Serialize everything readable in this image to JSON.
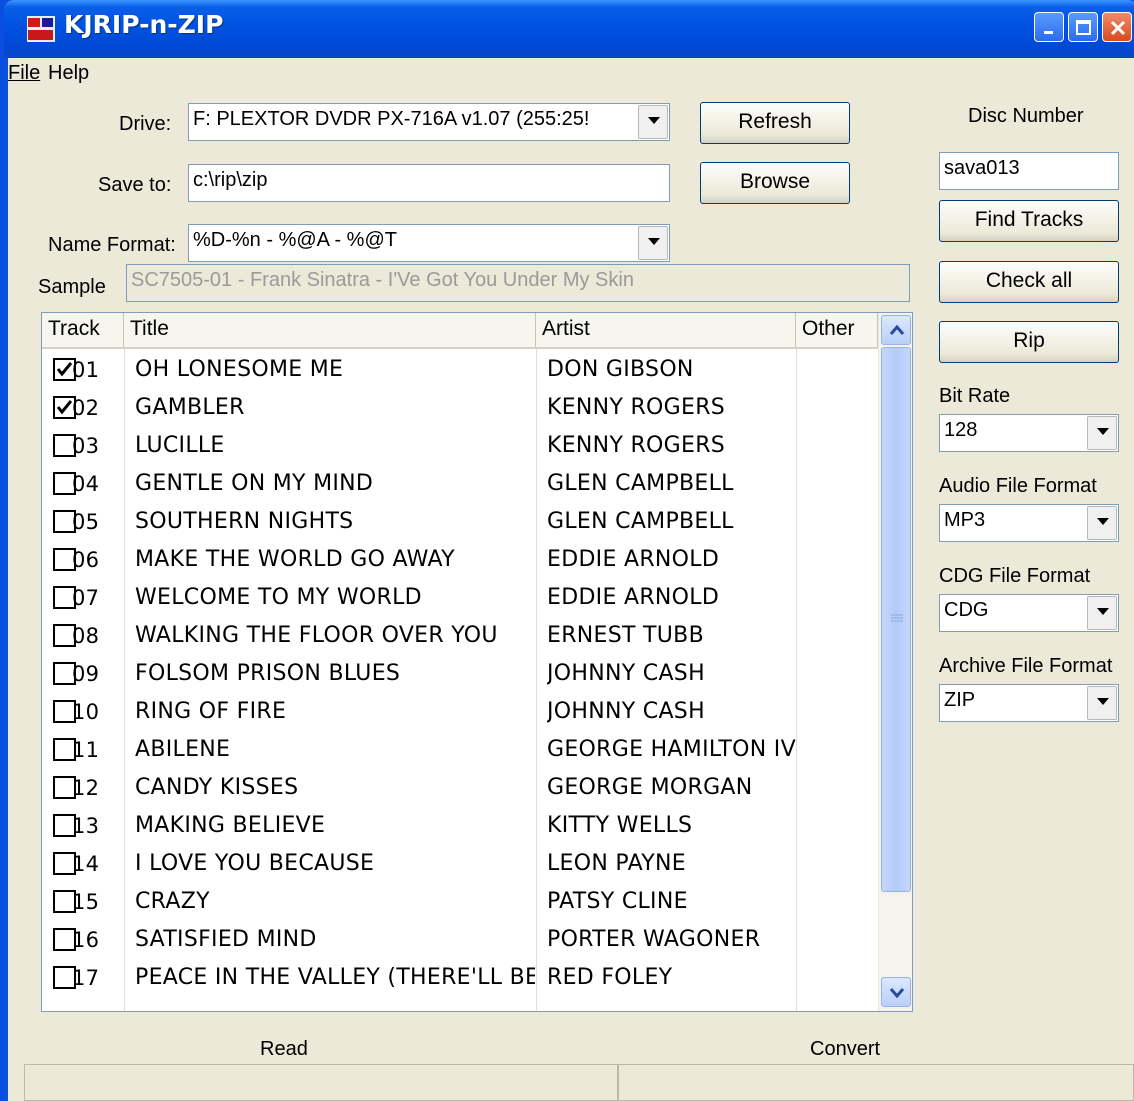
{
  "window": {
    "title": "KJRIP-n-ZIP",
    "accent": "#0052e0"
  },
  "menu": {
    "file": "File",
    "help": "Help"
  },
  "drive": {
    "label": "Drive:",
    "value": "F: PLEXTOR DVDR   PX-716A v1.07 (255:25!"
  },
  "save_to": {
    "label": "Save to:",
    "value": "c:\\rip\\zip"
  },
  "name_format": {
    "label": "Name Format:",
    "value": "%D-%n - %@A - %@T"
  },
  "sample": {
    "label": "Sample",
    "value": "SC7505-01 - Frank Sinatra - I'Ve Got You Under My Skin"
  },
  "buttons": {
    "refresh": "Refresh",
    "browse": "Browse",
    "find_tracks": "Find Tracks",
    "check_all": "Check all",
    "rip": "Rip"
  },
  "disc_number": {
    "label": "Disc Number",
    "value": "sava013"
  },
  "bit_rate": {
    "label": "Bit Rate",
    "value": "128"
  },
  "audio_format": {
    "label": "Audio File Format",
    "value": "MP3"
  },
  "cdg_format": {
    "label": "CDG File Format",
    "value": "CDG"
  },
  "archive_format": {
    "label": "Archive File Format",
    "value": "ZIP"
  },
  "columns": {
    "track": "Track",
    "title": "Title",
    "artist": "Artist",
    "other": "Other"
  },
  "tracks": [
    {
      "track": "01",
      "title": "OH LONESOME ME",
      "artist": "DON GIBSON",
      "checked": true
    },
    {
      "track": "02",
      "title": "GAMBLER",
      "artist": "KENNY ROGERS",
      "checked": true
    },
    {
      "track": "03",
      "title": "LUCILLE",
      "artist": "KENNY ROGERS",
      "checked": false
    },
    {
      "track": "04",
      "title": "GENTLE ON MY MIND",
      "artist": "GLEN CAMPBELL",
      "checked": false
    },
    {
      "track": "05",
      "title": "SOUTHERN NIGHTS",
      "artist": "GLEN CAMPBELL",
      "checked": false
    },
    {
      "track": "06",
      "title": "MAKE THE WORLD GO AWAY",
      "artist": "EDDIE ARNOLD",
      "checked": false
    },
    {
      "track": "07",
      "title": "WELCOME TO MY WORLD",
      "artist": "EDDIE ARNOLD",
      "checked": false
    },
    {
      "track": "08",
      "title": "WALKING THE FLOOR OVER YOU",
      "artist": "ERNEST TUBB",
      "checked": false
    },
    {
      "track": "09",
      "title": "FOLSOM PRISON BLUES",
      "artist": "JOHNNY CASH",
      "checked": false
    },
    {
      "track": "10",
      "title": "RING OF FIRE",
      "artist": "JOHNNY CASH",
      "checked": false
    },
    {
      "track": "11",
      "title": "ABILENE",
      "artist": "GEORGE HAMILTON IV",
      "checked": false
    },
    {
      "track": "12",
      "title": "CANDY KISSES",
      "artist": "GEORGE MORGAN",
      "checked": false
    },
    {
      "track": "13",
      "title": "MAKING BELIEVE",
      "artist": "KITTY WELLS",
      "checked": false
    },
    {
      "track": "14",
      "title": "I LOVE YOU BECAUSE",
      "artist": "LEON PAYNE",
      "checked": false
    },
    {
      "track": "15",
      "title": "CRAZY",
      "artist": "PATSY CLINE",
      "checked": false
    },
    {
      "track": "16",
      "title": "SATISFIED MIND",
      "artist": "PORTER WAGONER",
      "checked": false
    },
    {
      "track": "17",
      "title": "PEACE IN THE VALLEY (THERE'LL BE)",
      "artist": "RED FOLEY",
      "checked": false
    }
  ],
  "status": {
    "read": "Read",
    "convert": "Convert"
  }
}
